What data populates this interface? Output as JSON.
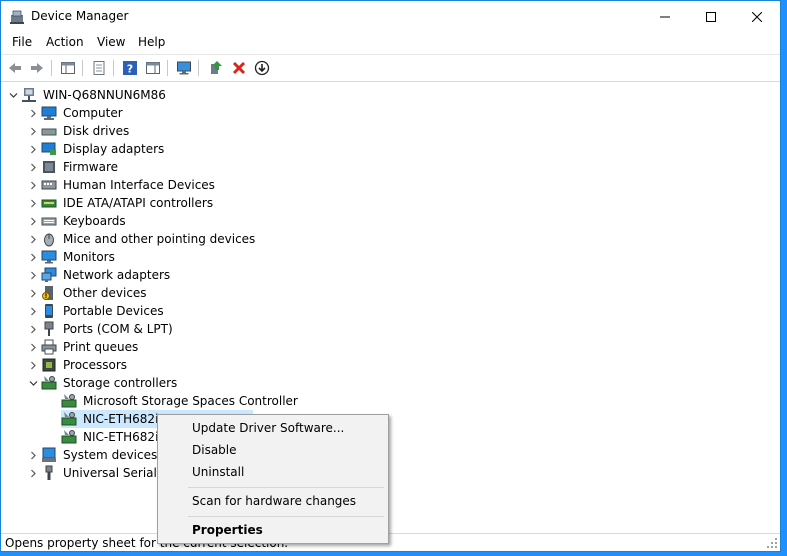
{
  "window": {
    "title": "Device Manager"
  },
  "menu": {
    "file": "File",
    "action": "Action",
    "view": "View",
    "help": "Help"
  },
  "tree": {
    "root": "WIN-Q68NNUN6M86",
    "items": [
      "Computer",
      "Disk drives",
      "Display adapters",
      "Firmware",
      "Human Interface Devices",
      "IDE ATA/ATAPI controllers",
      "Keyboards",
      "Mice and other pointing devices",
      "Monitors",
      "Network adapters",
      "Other devices",
      "Portable Devices",
      "Ports (COM & LPT)",
      "Print queues",
      "Processors",
      "Storage controllers"
    ],
    "storage_children": [
      "Microsoft Storage Spaces Controller",
      "NIC-ETH682i-",
      "NIC-ETH682i-"
    ],
    "after": [
      "System devices",
      "Universal Serial Bu"
    ]
  },
  "context_menu": {
    "update": "Update Driver Software...",
    "disable": "Disable",
    "uninstall": "Uninstall",
    "scan": "Scan for hardware changes",
    "properties": "Properties"
  },
  "status": {
    "text": "Opens property sheet for the current selection."
  },
  "colors": {
    "selection": "#cce8ff",
    "window_border": "#1883d7",
    "accent_red": "#d9261c",
    "accent_green": "#2e9a3e"
  }
}
